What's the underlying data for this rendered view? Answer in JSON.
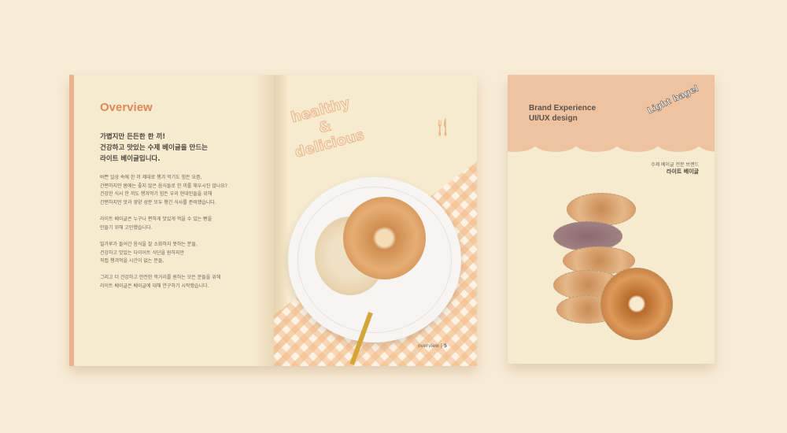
{
  "brochure": {
    "left_page": {
      "heading": "Overview",
      "lead": [
        "가볍지만 든든한 한 끼!",
        "건강하고 맛있는 수제 베이글을 만드는",
        "라이트 베이글입니다."
      ],
      "paragraphs": [
        [
          "바쁜 일상 속에 한 끼 제대로 챙겨 먹기도 힘든 요즘,",
          "간편하지만 몸에는 좋지 않은 음식들로 한 끼를 채우시진 않나요?",
          "건강한 식사 한 끼도 챙겨먹기 힘든 우리 현대인들을 위해",
          "간편하지만 맛과 영양 성분 모두 챙긴 식사를 준비했습니다."
        ],
        [
          "라이트 베이글은 누구나 편하게 맛있게 먹을 수 있는 빵을",
          "만들기 위해 고민했습니다."
        ],
        [
          "밀가루가 들어간 음식을 잘 소화하지 못하는 분들,",
          "건강하고 맛있는 다이어트 식단을 원하지만",
          "직접 챙겨먹을 시간이 없는 분들,"
        ],
        [
          "그리고 더 건강하고 안전한 먹거리를 원하는 모든 분들을 위해",
          "라이트 베이글은 베이글에 대해 연구하기 시작했습니다."
        ]
      ]
    },
    "right_page": {
      "hand_lettering": [
        "healthy",
        "&",
        "delicious"
      ],
      "folio_label": "overview",
      "page_number": "5"
    }
  },
  "cover": {
    "title": [
      "Brand Experience",
      "UI/UX design"
    ],
    "logo_text": "Light bagel",
    "subtitle": "수제 베이글 전문 브랜드",
    "brand_name": "라이트 베이글"
  },
  "colors": {
    "background": "#f9ecd6",
    "accent": "#e0875a",
    "band": "#efc3a0"
  }
}
